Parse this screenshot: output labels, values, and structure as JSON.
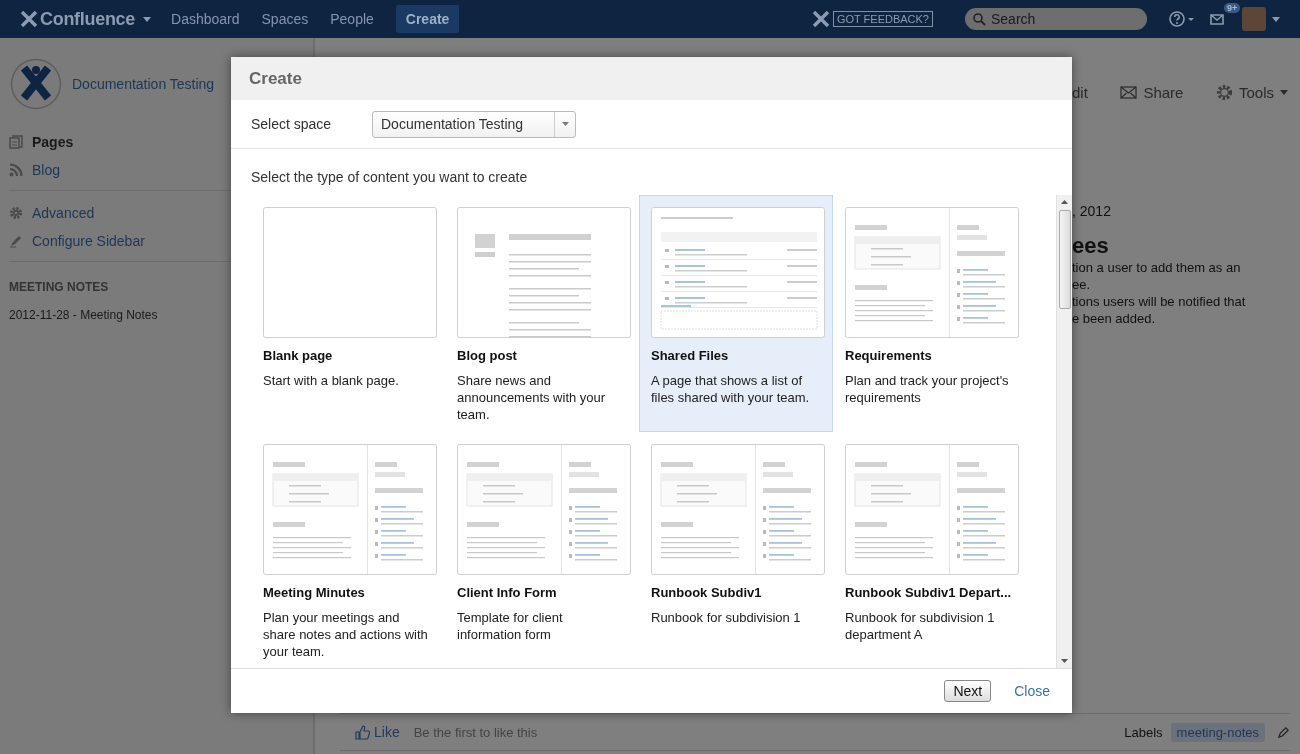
{
  "header": {
    "logo": "Confluence",
    "nav": [
      {
        "label": "Dashboard",
        "kind": "link"
      },
      {
        "label": "Spaces",
        "kind": "link"
      },
      {
        "label": "People",
        "kind": "link"
      },
      {
        "label": "Create",
        "kind": "button"
      }
    ],
    "feedback": "GOT FEEDBACK?",
    "search": {
      "placeholder": "Search"
    },
    "notifications": "9+"
  },
  "sidebar": {
    "space": "Documentation Testing",
    "items": [
      {
        "label": "Pages",
        "kind": "pages",
        "selected": true
      },
      {
        "label": "Blog",
        "kind": "blog",
        "selected": false
      }
    ],
    "tools": [
      {
        "label": "Advanced",
        "kind": "gear"
      },
      {
        "label": "Configure Sidebar",
        "kind": "pencil"
      }
    ],
    "section": "MEETING NOTES",
    "links": [
      "2012-11-28 - Meeting Notes"
    ]
  },
  "page": {
    "actions": [
      {
        "label": "dit",
        "kind": "plain"
      },
      {
        "label": "Share",
        "kind": "mail"
      },
      {
        "label": "Tools",
        "kind": "gear"
      }
    ],
    "date": ", 2012",
    "heading": "ees",
    "lines": [
      "tion a user to add them as an",
      "ee.",
      "tions users will be notified that",
      "e been added."
    ],
    "like": "Like",
    "like_note": "Be the first to like this",
    "labels_title": "Labels",
    "labels": [
      "meeting-notes"
    ]
  },
  "dialog": {
    "title": "Create",
    "space_label": "Select space",
    "space_value": "Documentation Testing",
    "prompt": "Select the type of content you want to create",
    "templates": [
      {
        "title": "Blank page",
        "description": "Start with a blank page.",
        "kind": "blank",
        "selected": false
      },
      {
        "title": "Blog post",
        "description": "Share news and announcements with your team.",
        "kind": "blog",
        "selected": false
      },
      {
        "title": "Shared Files",
        "description": "A page that shows a list of files shared with your team.",
        "kind": "files",
        "selected": true
      },
      {
        "title": "Requirements",
        "description": "Plan and track your project's requirements",
        "kind": "split",
        "selected": false
      },
      {
        "title": "Meeting Minutes",
        "description": "Plan your meetings and share notes and actions with your team.",
        "kind": "split",
        "selected": false
      },
      {
        "title": "Client Info Form",
        "description": "Template for client information form",
        "kind": "split",
        "selected": false
      },
      {
        "title": "Runbook Subdiv1",
        "description": "Runbook for subdivision 1",
        "kind": "split",
        "selected": false
      },
      {
        "title": "Runbook Subdiv1 Depart...",
        "description": "Runbook for subdivision 1 department A",
        "kind": "split",
        "selected": false
      }
    ],
    "next": "Next",
    "close": "Close"
  }
}
